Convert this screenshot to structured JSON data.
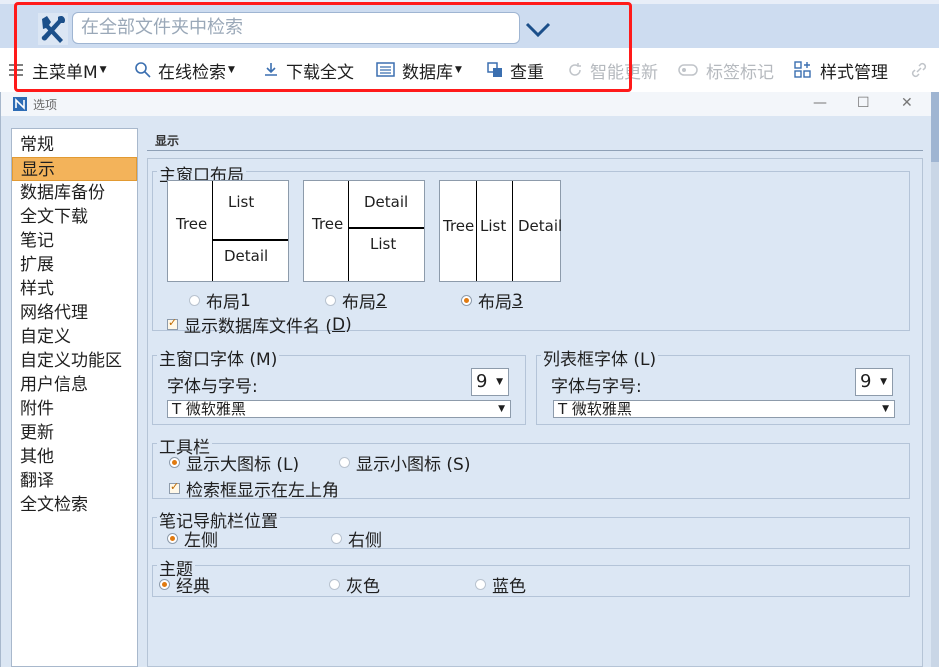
{
  "app": {
    "search_placeholder": "在全部文件夹中检索",
    "toolbar": {
      "main_menu": "主菜单M",
      "online_search": "在线检索",
      "download_fulltext": "下载全文",
      "database": "数据库",
      "dedupe": "查重",
      "smart_update": "智能更新",
      "tag_mark": "标签标记",
      "style_manage": "样式管理"
    }
  },
  "dialog": {
    "title": "选项",
    "nav": {
      "items": [
        "常规",
        "显示",
        "数据库备份",
        "全文下载",
        "笔记",
        "扩展",
        "样式",
        "网络代理",
        "自定义",
        "自定义功能区",
        "用户信息",
        "附件",
        "更新",
        "其他",
        "翻译",
        "全文检索"
      ],
      "selected_index": 1
    },
    "section_title": "显示",
    "main_layout": {
      "title": "主窗口布局",
      "boxes": [
        {
          "tree": "Tree",
          "list": "List",
          "detail": "Detail"
        },
        {
          "tree": "Tree",
          "detail": "Detail",
          "list": "List"
        },
        {
          "tree": "Tree",
          "list": "List",
          "detail": "Detail"
        }
      ],
      "options": [
        {
          "label": "布局 ",
          "key": "1",
          "selected": false
        },
        {
          "label": "布局 ",
          "key": "2",
          "selected": false
        },
        {
          "label": "布局 ",
          "key": "3",
          "selected": true
        }
      ],
      "show_db_filename_label": "显示数据库文件名 (",
      "show_db_filename_key": "D",
      "show_db_filename_close": ")",
      "show_db_filename_checked": true
    },
    "main_font": {
      "title": "主窗口字体 (M)",
      "size_label": "字体与字号:",
      "size_value": "9",
      "font_value": "T 微软雅黑"
    },
    "list_font": {
      "title": "列表框字体 (L)",
      "size_label": "字体与字号:",
      "size_value": "9",
      "font_value": "T 微软雅黑"
    },
    "toolbar_group": {
      "title": "工具栏",
      "large_icons": "显示大图标 (L)",
      "small_icons": "显示小图标 (S)",
      "large_selected": true,
      "search_top_left": "检索框显示在左上角",
      "search_top_left_checked": true
    },
    "note_nav": {
      "title": "笔记导航栏位置",
      "left": "左侧",
      "right": "右侧",
      "selected": "left"
    },
    "theme": {
      "title": "主题",
      "options": [
        "经典",
        "灰色",
        "蓝色"
      ],
      "selected_index": 0
    }
  }
}
